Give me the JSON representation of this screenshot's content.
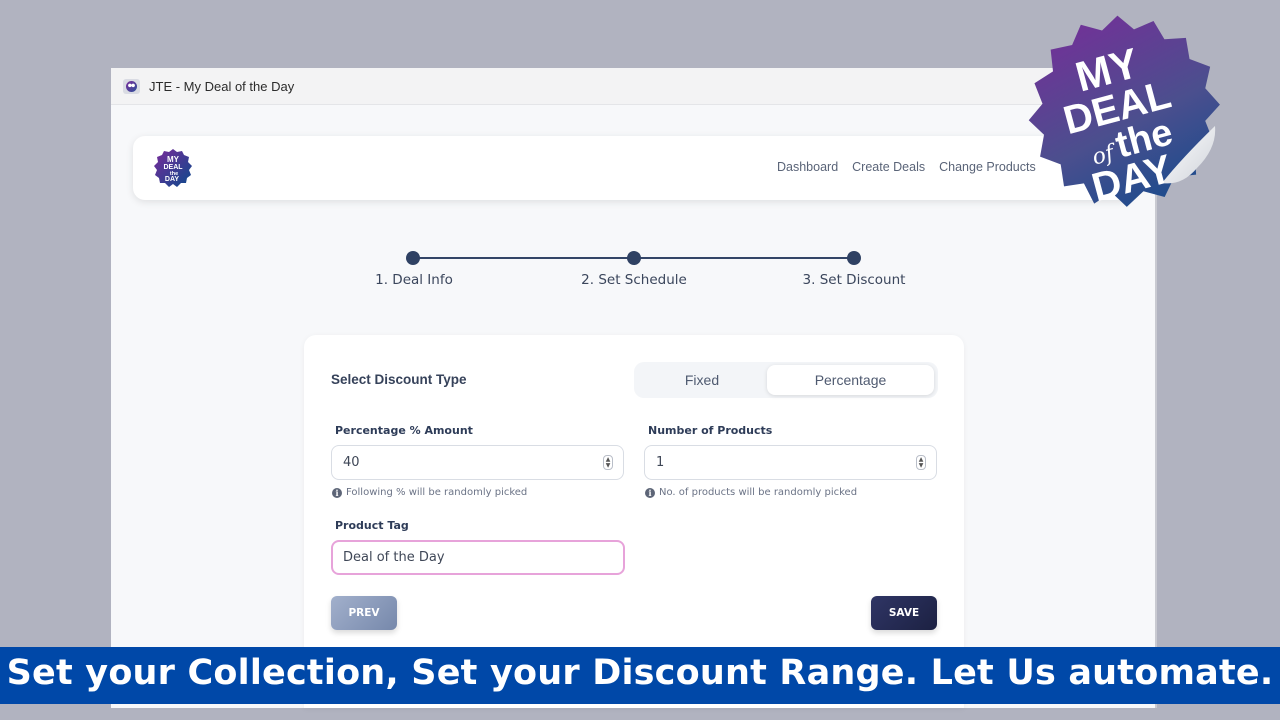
{
  "window": {
    "title": "JTE - My Deal of the Day",
    "favicon": "app-favicon-icon"
  },
  "navbar": {
    "logo_alt": "My Deal of the Day logo",
    "links": [
      "Dashboard",
      "Create Deals",
      "Change Products"
    ]
  },
  "stepper": {
    "steps": [
      {
        "label": "1. Deal Info",
        "complete": true
      },
      {
        "label": "2. Set Schedule",
        "complete": true
      },
      {
        "label": "3. Set Discount",
        "complete": true
      }
    ],
    "current_step": 3
  },
  "form": {
    "discount_type_label": "Select Discount Type",
    "discount_type_options": [
      "Fixed",
      "Percentage"
    ],
    "discount_type_selected": "Percentage",
    "percentage": {
      "label": "Percentage % Amount",
      "value": "40",
      "hint": "Following % will be randomly picked"
    },
    "num_products": {
      "label": "Number of Products",
      "value": "1",
      "hint": "No. of products will be randomly picked"
    },
    "product_tag": {
      "label": "Product Tag",
      "value": "Deal of the Day"
    },
    "prev_label": "PREV",
    "save_label": "SAVE"
  },
  "badge": {
    "line1": "MY",
    "line2": "DEAL",
    "line3_of": "of",
    "line3_the": "the",
    "line4": "DAY",
    "colors": {
      "start": "#7b2a9a",
      "end": "#0a4a8c"
    }
  },
  "banner": {
    "text": "Set your Collection, Set your Discount Range. Let Us automate.",
    "color": "#0048a8"
  }
}
